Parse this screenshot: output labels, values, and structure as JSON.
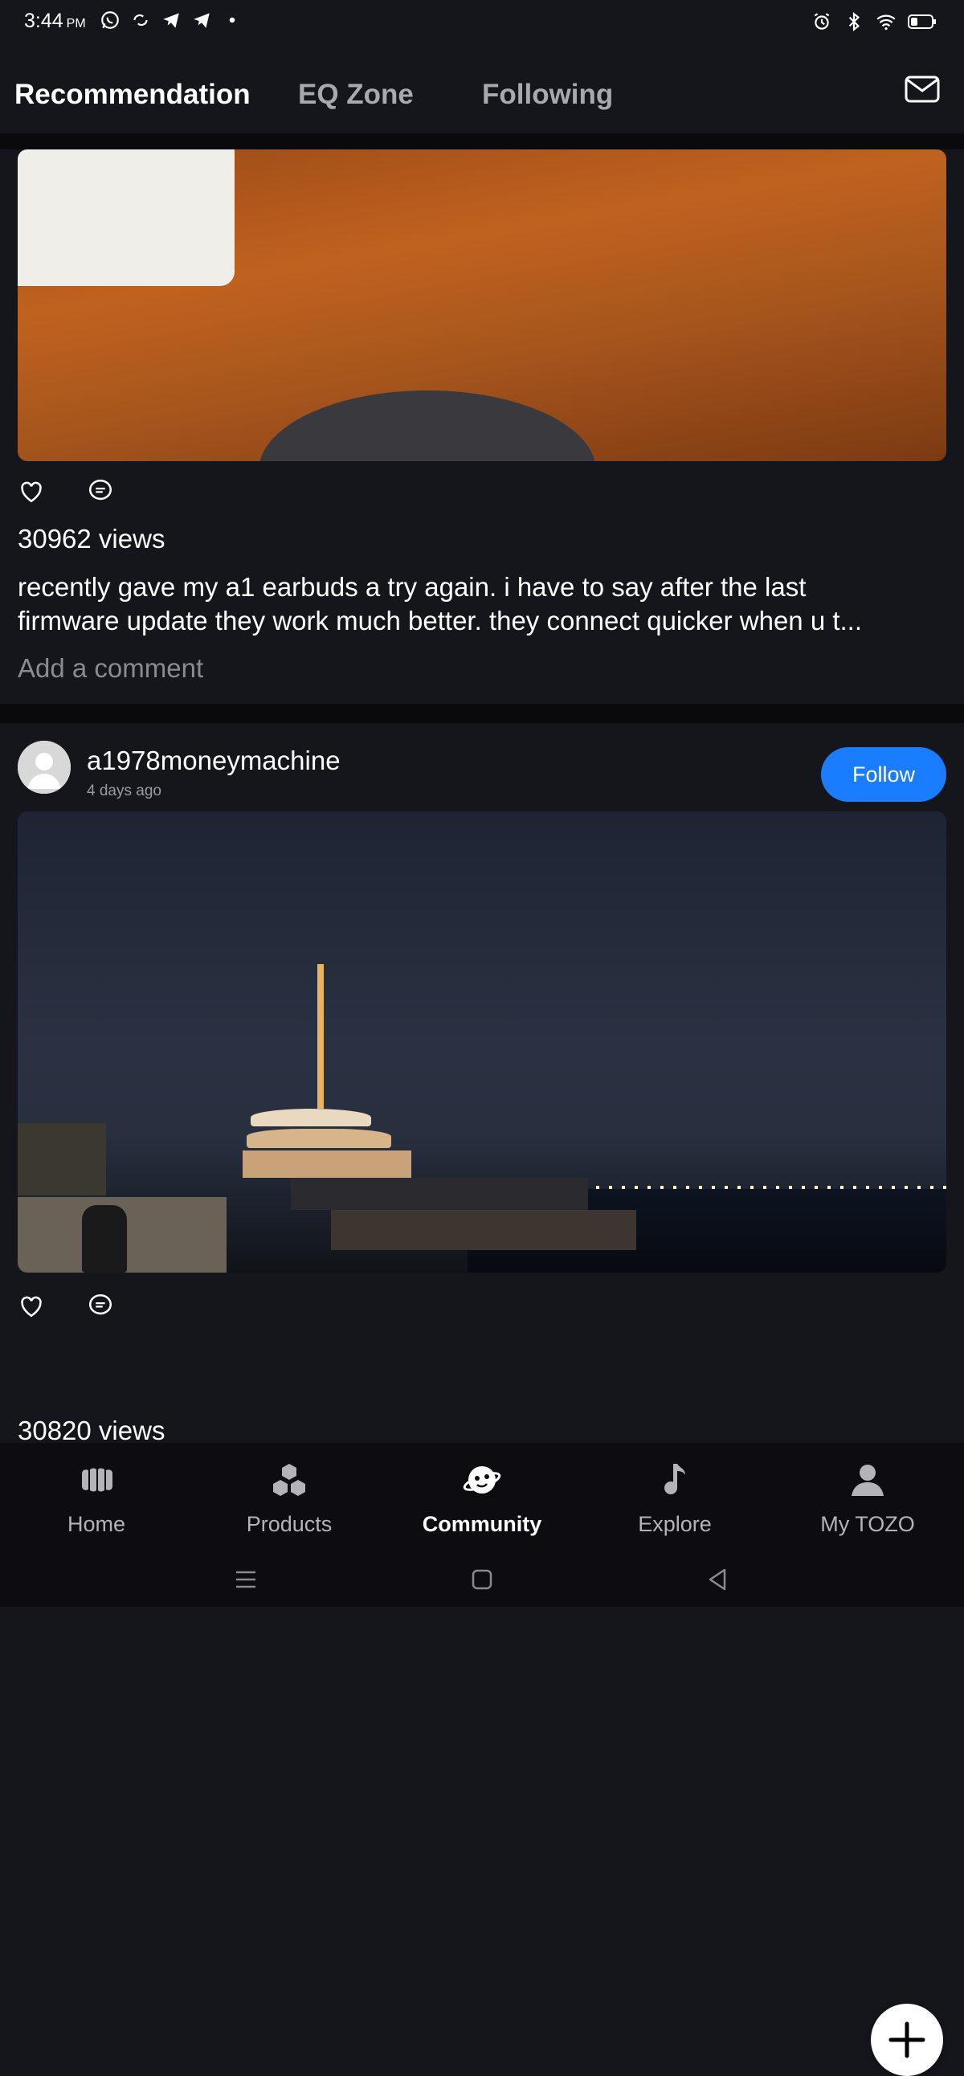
{
  "status_bar": {
    "time": "3:44",
    "ampm": "PM",
    "left_icons": [
      "whatsapp-icon",
      "sync-icon",
      "telegram-icon",
      "telegram-icon",
      "dot-icon"
    ],
    "right_icons": [
      "alarm-icon",
      "bluetooth-icon",
      "wifi-icon",
      "battery-icon"
    ]
  },
  "top_tabs": {
    "tabs": [
      {
        "label": "Recommendation",
        "active": true
      },
      {
        "label": "EQ Zone",
        "active": false
      },
      {
        "label": "Following",
        "active": false
      }
    ],
    "mail_icon": "mail-icon"
  },
  "post1": {
    "image_desc_icon": "photo",
    "views": "30962 views",
    "caption_line1": "recently gave my a1 earbuds a try again. i have to say after the last",
    "caption_line2": "firmware update they work much better. they connect quicker when u t...",
    "comment_placeholder": "Add a comment"
  },
  "post2": {
    "username": "a1978moneymachine",
    "time_ago": "4 days ago",
    "follow_label": "Follow",
    "views": "30820 views"
  },
  "bottom_nav": {
    "items": [
      {
        "label": "Home",
        "icon": "home-icon"
      },
      {
        "label": "Products",
        "icon": "products-icon"
      },
      {
        "label": "Community",
        "icon": "community-icon",
        "active": true
      },
      {
        "label": "Explore",
        "icon": "music-note-icon"
      },
      {
        "label": "My TOZO",
        "icon": "person-icon"
      }
    ]
  },
  "colors": {
    "background": "#15151c",
    "accent": "#1a7cff"
  }
}
